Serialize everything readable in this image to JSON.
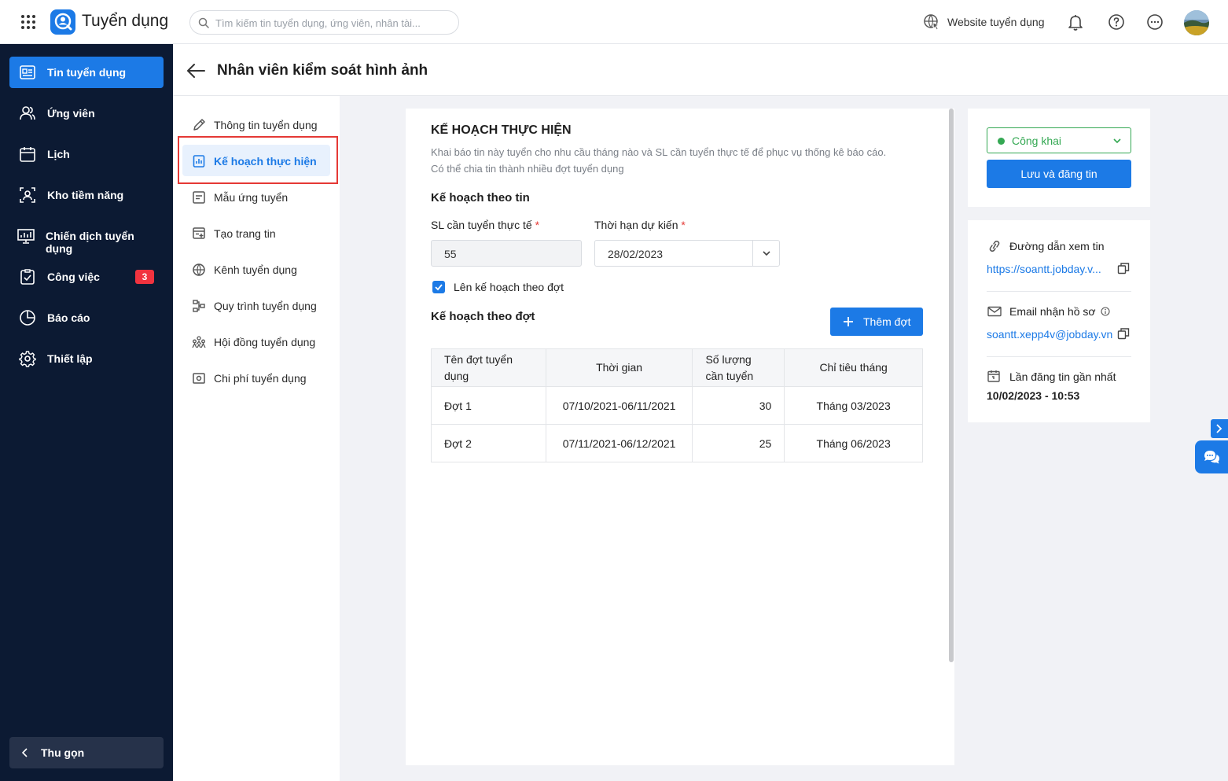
{
  "app": {
    "title": "Tuyển dụng"
  },
  "search": {
    "placeholder": "Tìm kiếm tin tuyển dụng, ứng viên, nhân tài..."
  },
  "topbar": {
    "website_label": "Website tuyển dụng"
  },
  "sidebar": {
    "items": [
      {
        "label": "Tin tuyển dụng",
        "icon": "job-post-icon",
        "active": true
      },
      {
        "label": "Ứng viên",
        "icon": "users-icon"
      },
      {
        "label": "Lịch",
        "icon": "calendar-icon"
      },
      {
        "label": "Kho tiềm năng",
        "icon": "talent-pool-icon"
      },
      {
        "label": "Chiến dịch tuyển dụng",
        "icon": "campaign-icon"
      },
      {
        "label": "Công việc",
        "icon": "task-icon",
        "badge": "3"
      },
      {
        "label": "Báo cáo",
        "icon": "report-icon"
      },
      {
        "label": "Thiết lập",
        "icon": "gear-icon"
      }
    ],
    "collapse_label": "Thu gọn"
  },
  "page": {
    "title": "Nhân viên kiểm soát hình ảnh"
  },
  "submenu": {
    "items": [
      {
        "label": "Thông tin tuyển dụng",
        "icon": "pencil-icon"
      },
      {
        "label": "Kế hoạch thực hiện",
        "icon": "plan-icon",
        "active": true
      },
      {
        "label": "Mẫu ứng tuyển",
        "icon": "form-icon"
      },
      {
        "label": "Tạo trang tin",
        "icon": "page-icon"
      },
      {
        "label": "Kênh tuyển dụng",
        "icon": "globe-icon"
      },
      {
        "label": "Quy trình tuyển dụng",
        "icon": "flow-icon"
      },
      {
        "label": "Hội đồng tuyển dụng",
        "icon": "committee-icon"
      },
      {
        "label": "Chi phí tuyển dụng",
        "icon": "money-icon"
      }
    ]
  },
  "plan": {
    "title": "KẾ HOẠCH THỰC HIỆN",
    "desc_line1": "Khai báo tin này tuyển cho nhu cầu tháng nào và SL cần tuyển thực tế để phục vụ thống kê báo cáo.",
    "desc_line2": "Có thể chia tin thành nhiều đợt tuyển dụng",
    "by_post_title": "Kế hoạch theo tin",
    "qty_label": "SL cần tuyển thực tế",
    "qty_value": "55",
    "deadline_label": "Thời hạn dự kiến",
    "deadline_value": "28/02/2023",
    "by_batch_checkbox": "Lên kế hoạch theo đợt",
    "by_batch_title": "Kế hoạch theo đợt",
    "add_batch_label": "Thêm đợt",
    "table": {
      "headers": [
        "Tên đợt tuyển dụng",
        "Thời gian",
        "Số lượng cần tuyển",
        "Chỉ tiêu tháng"
      ],
      "rows": [
        {
          "name": "Đợt 1",
          "time": "07/10/2021-06/11/2021",
          "qty": "30",
          "month": "Tháng 03/2023"
        },
        {
          "name": "Đợt 2",
          "time": "07/11/2021-06/12/2021",
          "qty": "25",
          "month": "Tháng 06/2023"
        }
      ]
    }
  },
  "right": {
    "status": "Công khai",
    "save_label": "Lưu và đăng tin",
    "link_label": "Đường dẫn xem tin",
    "link_value": "https://soantt.jobday.v...",
    "email_label": "Email nhận hồ sơ",
    "email_value": "soantt.xepp4v@jobday.vn",
    "last_post_label": "Lần đăng tin gần nhất",
    "last_post_value": "10/02/2023 - 10:53"
  },
  "colors": {
    "primary": "#1c7ae6",
    "sidebar": "#0c1a33",
    "success": "#34a853",
    "danger": "#e53935"
  }
}
